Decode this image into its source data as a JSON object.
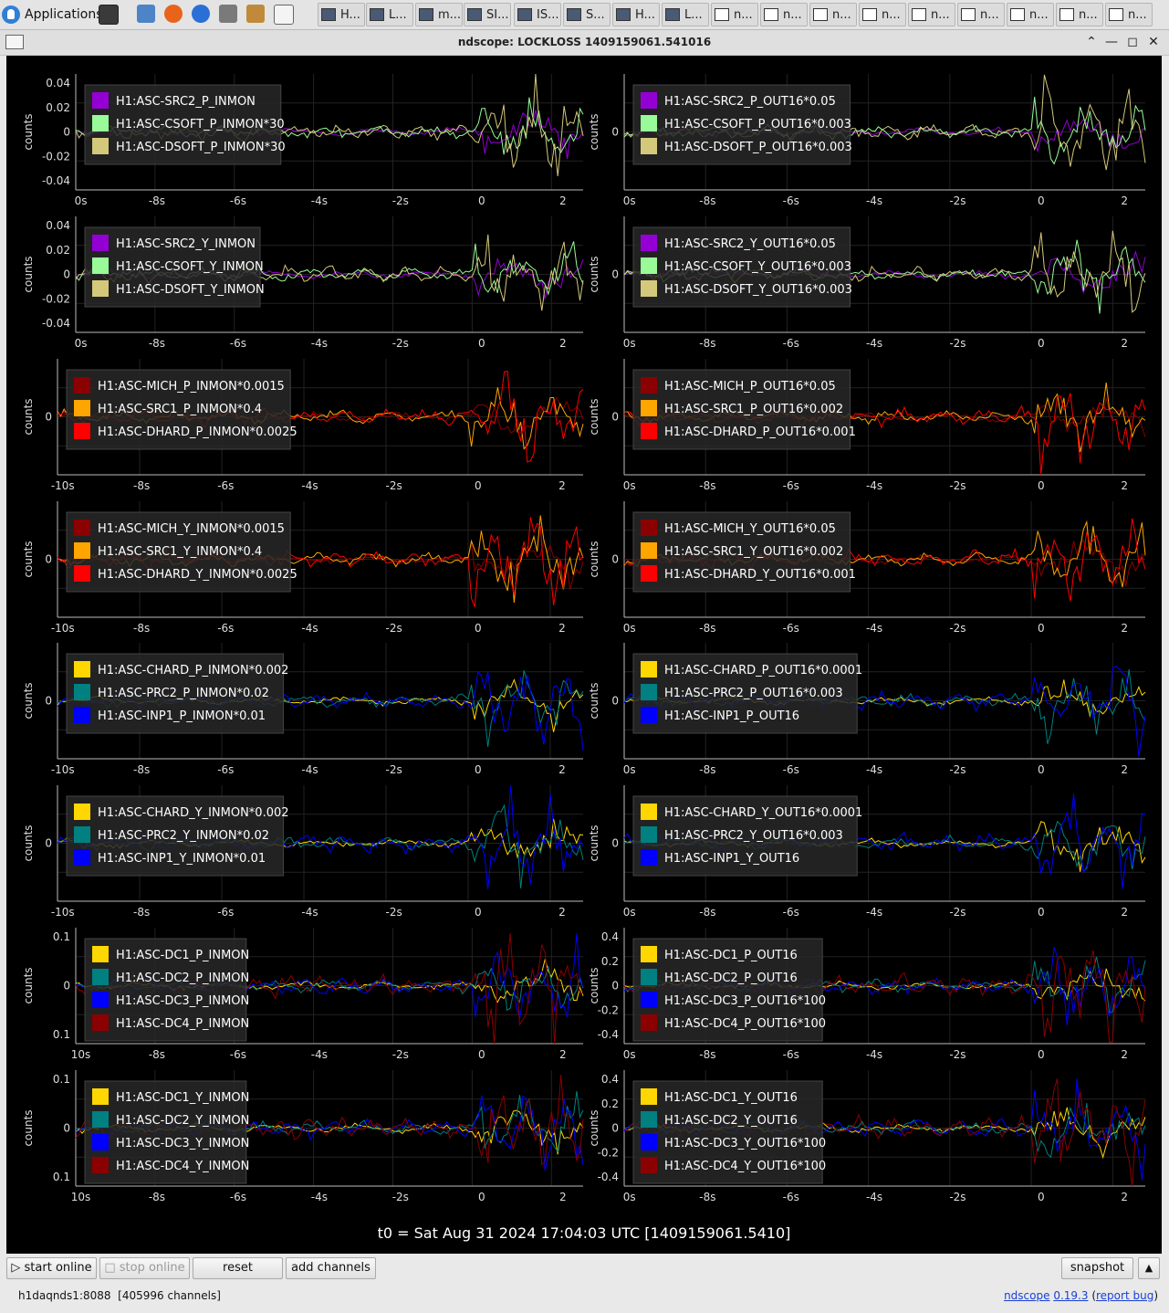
{
  "taskbar": {
    "applications_label": "Applications",
    "window_buttons": [
      "H...",
      "L...",
      "m...",
      "SI...",
      "IS...",
      "S...",
      "H...",
      "L...",
      "n...",
      "n...",
      "n...",
      "n...",
      "n...",
      "n...",
      "n...",
      "n...",
      "n..."
    ]
  },
  "window": {
    "title": "ndscope: LOCKLOSS 1409159061.541016"
  },
  "axis_y_label": "counts",
  "colors": {
    "purple": "#9400d3",
    "lightgreen": "#98fb98",
    "khaki": "#d4c87a",
    "darkred": "#8b0000",
    "orange": "#ffa500",
    "red": "#ff0000",
    "gold": "#ffd700",
    "teal": "#008080",
    "blue": "#0000ff"
  },
  "plots": [
    {
      "col": 0,
      "row": 0,
      "x_ticks": [
        "0s",
        "-8s",
        "-6s",
        "-4s",
        "-2s",
        "0",
        "2"
      ],
      "y_ticks": [
        "0.04",
        "0.02",
        "0",
        "-0.02",
        "-0.04"
      ],
      "legend": [
        {
          "color": "#9400d3",
          "label": "H1:ASC-SRC2_P_INMON"
        },
        {
          "color": "#98fb98",
          "label": "H1:ASC-CSOFT_P_INMON*30"
        },
        {
          "color": "#d4c87a",
          "label": "H1:ASC-DSOFT_P_INMON*30"
        }
      ]
    },
    {
      "col": 1,
      "row": 0,
      "x_ticks": [
        "0s",
        "-8s",
        "-6s",
        "-4s",
        "-2s",
        "0",
        "2"
      ],
      "y_ticks": [
        "0"
      ],
      "legend": [
        {
          "color": "#9400d3",
          "label": "H1:ASC-SRC2_P_OUT16*0.05"
        },
        {
          "color": "#98fb98",
          "label": "H1:ASC-CSOFT_P_OUT16*0.003"
        },
        {
          "color": "#d4c87a",
          "label": "H1:ASC-DSOFT_P_OUT16*0.003"
        }
      ]
    },
    {
      "col": 0,
      "row": 1,
      "x_ticks": [
        "0s",
        "-8s",
        "-6s",
        "-4s",
        "-2s",
        "0",
        "2"
      ],
      "y_ticks": [
        "0.04",
        "0.02",
        "0",
        "-0.02",
        "-0.04"
      ],
      "legend": [
        {
          "color": "#9400d3",
          "label": "H1:ASC-SRC2_Y_INMON"
        },
        {
          "color": "#98fb98",
          "label": "H1:ASC-CSOFT_Y_INMON"
        },
        {
          "color": "#d4c87a",
          "label": "H1:ASC-DSOFT_Y_INMON"
        }
      ]
    },
    {
      "col": 1,
      "row": 1,
      "x_ticks": [
        "0s",
        "-8s",
        "-6s",
        "-4s",
        "-2s",
        "0",
        "2"
      ],
      "y_ticks": [
        "0"
      ],
      "legend": [
        {
          "color": "#9400d3",
          "label": "H1:ASC-SRC2_Y_OUT16*0.05"
        },
        {
          "color": "#98fb98",
          "label": "H1:ASC-CSOFT_Y_OUT16*0.003"
        },
        {
          "color": "#d4c87a",
          "label": "H1:ASC-DSOFT_Y_OUT16*0.003"
        }
      ]
    },
    {
      "col": 0,
      "row": 2,
      "x_ticks": [
        "-10s",
        "-8s",
        "-6s",
        "-4s",
        "-2s",
        "0",
        "2"
      ],
      "y_ticks": [
        "0"
      ],
      "legend": [
        {
          "color": "#8b0000",
          "label": "H1:ASC-MICH_P_INMON*0.0015"
        },
        {
          "color": "#ffa500",
          "label": "H1:ASC-SRC1_P_INMON*0.4"
        },
        {
          "color": "#ff0000",
          "label": "H1:ASC-DHARD_P_INMON*0.0025"
        }
      ]
    },
    {
      "col": 1,
      "row": 2,
      "x_ticks": [
        "0s",
        "-8s",
        "-6s",
        "-4s",
        "-2s",
        "0",
        "2"
      ],
      "y_ticks": [
        "0"
      ],
      "legend": [
        {
          "color": "#8b0000",
          "label": "H1:ASC-MICH_P_OUT16*0.05"
        },
        {
          "color": "#ffa500",
          "label": "H1:ASC-SRC1_P_OUT16*0.002"
        },
        {
          "color": "#ff0000",
          "label": "H1:ASC-DHARD_P_OUT16*0.001"
        }
      ]
    },
    {
      "col": 0,
      "row": 3,
      "x_ticks": [
        "-10s",
        "-8s",
        "-6s",
        "-4s",
        "-2s",
        "0",
        "2"
      ],
      "y_ticks": [
        "0"
      ],
      "legend": [
        {
          "color": "#8b0000",
          "label": "H1:ASC-MICH_Y_INMON*0.0015"
        },
        {
          "color": "#ffa500",
          "label": "H1:ASC-SRC1_Y_INMON*0.4"
        },
        {
          "color": "#ff0000",
          "label": "H1:ASC-DHARD_Y_INMON*0.0025"
        }
      ]
    },
    {
      "col": 1,
      "row": 3,
      "x_ticks": [
        "0s",
        "-8s",
        "-6s",
        "-4s",
        "-2s",
        "0",
        "2"
      ],
      "y_ticks": [
        "0"
      ],
      "legend": [
        {
          "color": "#8b0000",
          "label": "H1:ASC-MICH_Y_OUT16*0.05"
        },
        {
          "color": "#ffa500",
          "label": "H1:ASC-SRC1_Y_OUT16*0.002"
        },
        {
          "color": "#ff0000",
          "label": "H1:ASC-DHARD_Y_OUT16*0.001"
        }
      ]
    },
    {
      "col": 0,
      "row": 4,
      "x_ticks": [
        "-10s",
        "-8s",
        "-6s",
        "-4s",
        "-2s",
        "0",
        "2"
      ],
      "y_ticks": [
        "0"
      ],
      "legend": [
        {
          "color": "#ffd700",
          "label": "H1:ASC-CHARD_P_INMON*0.002"
        },
        {
          "color": "#008080",
          "label": "H1:ASC-PRC2_P_INMON*0.02"
        },
        {
          "color": "#0000ff",
          "label": "H1:ASC-INP1_P_INMON*0.01"
        }
      ]
    },
    {
      "col": 1,
      "row": 4,
      "x_ticks": [
        "0s",
        "-8s",
        "-6s",
        "-4s",
        "-2s",
        "0",
        "2"
      ],
      "y_ticks": [
        "0"
      ],
      "legend": [
        {
          "color": "#ffd700",
          "label": "H1:ASC-CHARD_P_OUT16*0.0001"
        },
        {
          "color": "#008080",
          "label": "H1:ASC-PRC2_P_OUT16*0.003"
        },
        {
          "color": "#0000ff",
          "label": "H1:ASC-INP1_P_OUT16"
        }
      ]
    },
    {
      "col": 0,
      "row": 5,
      "x_ticks": [
        "-10s",
        "-8s",
        "-6s",
        "-4s",
        "-2s",
        "0",
        "2"
      ],
      "y_ticks": [
        "0"
      ],
      "legend": [
        {
          "color": "#ffd700",
          "label": "H1:ASC-CHARD_Y_INMON*0.002"
        },
        {
          "color": "#008080",
          "label": "H1:ASC-PRC2_Y_INMON*0.02"
        },
        {
          "color": "#0000ff",
          "label": "H1:ASC-INP1_Y_INMON*0.01"
        }
      ]
    },
    {
      "col": 1,
      "row": 5,
      "x_ticks": [
        "0s",
        "-8s",
        "-6s",
        "-4s",
        "-2s",
        "0",
        "2"
      ],
      "y_ticks": [
        "0"
      ],
      "legend": [
        {
          "color": "#ffd700",
          "label": "H1:ASC-CHARD_Y_OUT16*0.0001"
        },
        {
          "color": "#008080",
          "label": "H1:ASC-PRC2_Y_OUT16*0.003"
        },
        {
          "color": "#0000ff",
          "label": "H1:ASC-INP1_Y_OUT16"
        }
      ]
    },
    {
      "col": 0,
      "row": 6,
      "x_ticks": [
        "10s",
        "-8s",
        "-6s",
        "-4s",
        "-2s",
        "0",
        "2"
      ],
      "y_ticks": [
        "0.1",
        "0",
        "0.1"
      ],
      "legend": [
        {
          "color": "#ffd700",
          "label": "H1:ASC-DC1_P_INMON"
        },
        {
          "color": "#008080",
          "label": "H1:ASC-DC2_P_INMON"
        },
        {
          "color": "#0000ff",
          "label": "H1:ASC-DC3_P_INMON"
        },
        {
          "color": "#8b0000",
          "label": "H1:ASC-DC4_P_INMON"
        }
      ]
    },
    {
      "col": 1,
      "row": 6,
      "x_ticks": [
        "0s",
        "-8s",
        "-6s",
        "-4s",
        "-2s",
        "0",
        "2"
      ],
      "y_ticks": [
        "0.4",
        "0.2",
        "0",
        "-0.2",
        "-0.4"
      ],
      "legend": [
        {
          "color": "#ffd700",
          "label": "H1:ASC-DC1_P_OUT16"
        },
        {
          "color": "#008080",
          "label": "H1:ASC-DC2_P_OUT16"
        },
        {
          "color": "#0000ff",
          "label": "H1:ASC-DC3_P_OUT16*100"
        },
        {
          "color": "#8b0000",
          "label": "H1:ASC-DC4_P_OUT16*100"
        }
      ]
    },
    {
      "col": 0,
      "row": 7,
      "x_ticks": [
        "10s",
        "-8s",
        "-6s",
        "-4s",
        "-2s",
        "0",
        "2"
      ],
      "y_ticks": [
        "0.1",
        "0",
        "0.1"
      ],
      "legend": [
        {
          "color": "#ffd700",
          "label": "H1:ASC-DC1_Y_INMON"
        },
        {
          "color": "#008080",
          "label": "H1:ASC-DC2_Y_INMON"
        },
        {
          "color": "#0000ff",
          "label": "H1:ASC-DC3_Y_INMON"
        },
        {
          "color": "#8b0000",
          "label": "H1:ASC-DC4_Y_INMON"
        }
      ]
    },
    {
      "col": 1,
      "row": 7,
      "x_ticks": [
        "0s",
        "-8s",
        "-6s",
        "-4s",
        "-2s",
        "0",
        "2"
      ],
      "y_ticks": [
        "0.4",
        "0.2",
        "0",
        "-0.2",
        "-0.4"
      ],
      "legend": [
        {
          "color": "#ffd700",
          "label": "H1:ASC-DC1_Y_OUT16"
        },
        {
          "color": "#008080",
          "label": "H1:ASC-DC2_Y_OUT16"
        },
        {
          "color": "#0000ff",
          "label": "H1:ASC-DC3_Y_OUT16*100"
        },
        {
          "color": "#8b0000",
          "label": "H1:ASC-DC4_Y_OUT16*100"
        }
      ]
    }
  ],
  "t0_label": "t0 = Sat Aug 31 2024 17:04:03 UTC [1409159061.5410]",
  "controls": {
    "start_online": "start online",
    "stop_online": "stop online",
    "reset": "reset",
    "add_channels": "add channels",
    "snapshot": "snapshot"
  },
  "status": {
    "server": "h1daqnds1:8088",
    "channels": "[405996 channels]",
    "app_name": "ndscope",
    "version": "0.19.3",
    "report_bug": "report bug"
  }
}
